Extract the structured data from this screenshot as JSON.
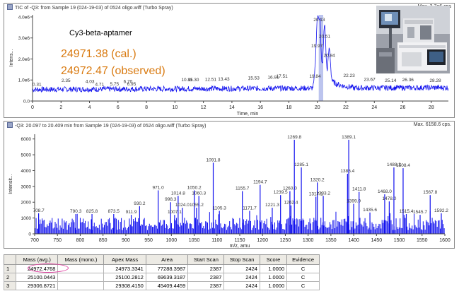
{
  "tic": {
    "title": "TIC of -Q3: from Sample 19 (024-19-03) of 0524 oligo.wiff (Turbo Spray)",
    "max_label": "Max. 3.7e6 cps",
    "sample_name": "Cy3-beta-aptamer",
    "calculated": "24971.38 (cal.)",
    "observed": "24972.47 (observed)"
  },
  "ms": {
    "title": "-Q3: 20.097 to 20.409 min from Sample 19 (024-19-03) of 0524 oligo.wiff (Turbo Spray)",
    "max_label": "Max. 6158.6 cps."
  },
  "colors": {
    "trace": "#1010ee",
    "caption": "#d97a10",
    "highlight": "#e040a0",
    "selection": "#bcc4ee"
  },
  "table": {
    "headers": [
      "",
      "Mass (avg.)",
      "Mass (mono.)",
      "Apex Mass",
      "Area",
      "Start Scan",
      "Stop Scan",
      "Score",
      "Evidence"
    ],
    "rows": [
      [
        "1",
        "24972.4768",
        "",
        "24973.3341",
        "77288.3987",
        "2387",
        "2424",
        "1.0000",
        "C"
      ],
      [
        "2",
        "25100.0443",
        "",
        "25100.2812",
        "69639.3187",
        "2387",
        "2424",
        "1.0000",
        "C"
      ],
      [
        "3",
        "29306.8721",
        "",
        "29308.4150",
        "45409.4459",
        "2387",
        "2424",
        "1.0000",
        "C"
      ]
    ]
  },
  "chart_data": [
    {
      "type": "line",
      "title": "TIC of -Q3: from Sample 19 (024-19-03) of 0524 oligo.wiff (Turbo Spray)",
      "xlabel": "Time, min",
      "ylabel": "Intens...",
      "xlim": [
        0,
        29.2
      ],
      "ylim": [
        0,
        4100000.0
      ],
      "x_ticks": [
        0,
        2,
        4,
        6,
        8,
        10,
        12,
        14,
        16,
        18,
        20,
        22,
        24,
        26,
        28
      ],
      "y_ticks": [
        {
          "v": 0,
          "label": "0.0"
        },
        {
          "v": 1000000.0,
          "label": "1.0e6"
        },
        {
          "v": 2000000.0,
          "label": "2.0e6"
        },
        {
          "v": 3000000.0,
          "label": "3.0e6"
        },
        {
          "v": 4000000.0,
          "label": "4.0e6"
        }
      ],
      "selection_range": [
        20.097,
        20.409
      ],
      "baseline": 550000.0,
      "peaks": [
        {
          "x": 19.84,
          "y": 1000000.0,
          "label": "19.84"
        },
        {
          "x": 19.97,
          "y": 2450000.0,
          "label": "19.97"
        },
        {
          "x": 20.13,
          "y": 3700000.0,
          "label": "20.13"
        },
        {
          "x": 20.51,
          "y": 2900000.0,
          "label": "20.51"
        },
        {
          "x": 20.84,
          "y": 2000000.0,
          "label": "20.84"
        }
      ],
      "annotations": [
        {
          "x": 0.31,
          "y": 630000.0,
          "label": "0.31"
        },
        {
          "x": 2.35,
          "y": 810000.0,
          "label": "2.35"
        },
        {
          "x": 4.03,
          "y": 760000.0,
          "label": "4.03"
        },
        {
          "x": 4.71,
          "y": 630000.0,
          "label": "4.71"
        },
        {
          "x": 5.75,
          "y": 640000.0,
          "label": "5.75"
        },
        {
          "x": 6.7,
          "y": 760000.0,
          "label": "6.70"
        },
        {
          "x": 6.95,
          "y": 640000.0,
          "label": "6.95"
        },
        {
          "x": 10.85,
          "y": 840000.0,
          "label": "10.85"
        },
        {
          "x": 11.3,
          "y": 840000.0,
          "label": "11.30"
        },
        {
          "x": 12.51,
          "y": 860000.0,
          "label": "12.51"
        },
        {
          "x": 13.43,
          "y": 880000.0,
          "label": "13.43"
        },
        {
          "x": 15.53,
          "y": 920000.0,
          "label": "15.53"
        },
        {
          "x": 16.91,
          "y": 960000.0,
          "label": "16.91"
        },
        {
          "x": 17.51,
          "y": 1000000.0,
          "label": "17.51"
        },
        {
          "x": 22.23,
          "y": 1050000.0,
          "label": "22.23"
        },
        {
          "x": 23.67,
          "y": 860000.0,
          "label": "23.67"
        },
        {
          "x": 25.14,
          "y": 810000.0,
          "label": "25.14"
        },
        {
          "x": 26.36,
          "y": 840000.0,
          "label": "26.36"
        },
        {
          "x": 28.28,
          "y": 810000.0,
          "label": "28.28"
        }
      ]
    },
    {
      "type": "bar",
      "title": "-Q3: 20.097 to 20.409 min from Sample 19 (024-19-03) of 0524 oligo.wiff (Turbo Spray)",
      "xlabel": "m/z, amu",
      "ylabel": "Intensit...",
      "xlim": [
        700,
        1600
      ],
      "ylim": [
        0,
        6300
      ],
      "x_ticks": [
        700,
        750,
        800,
        850,
        900,
        950,
        1000,
        1050,
        1100,
        1150,
        1200,
        1250,
        1300,
        1350,
        1400,
        1450,
        1500,
        1550,
        1600
      ],
      "y_ticks": [
        0,
        1000,
        2000,
        3000,
        4000,
        5000,
        6000
      ],
      "noise_floor": 600,
      "peaks": [
        {
          "x": 708.7,
          "y": 1300,
          "label": "708.7"
        },
        {
          "x": 790.3,
          "y": 1250,
          "label": "790.3"
        },
        {
          "x": 825.8,
          "y": 1250,
          "label": "825.8"
        },
        {
          "x": 873.5,
          "y": 1250,
          "label": "873.5"
        },
        {
          "x": 911.9,
          "y": 1200,
          "label": "911.9"
        },
        {
          "x": 930.2,
          "y": 1750,
          "label": "930.2"
        },
        {
          "x": 971.0,
          "y": 2750,
          "label": "971.0"
        },
        {
          "x": 998.3,
          "y": 2000,
          "label": "998.3"
        },
        {
          "x": 1007.1,
          "y": 1200,
          "label": "1007.1"
        },
        {
          "x": 1014.8,
          "y": 2400,
          "label": "1014.8"
        },
        {
          "x": 1024.0,
          "y": 1650,
          "label": "1024.0"
        },
        {
          "x": 1050.2,
          "y": 2750,
          "label": "1050.2"
        },
        {
          "x": 1055.2,
          "y": 1650,
          "label": "1055.2"
        },
        {
          "x": 1060.3,
          "y": 2400,
          "label": "1060.3"
        },
        {
          "x": 1091.8,
          "y": 4500,
          "label": "1091.8"
        },
        {
          "x": 1105.3,
          "y": 1450,
          "label": "1105.3"
        },
        {
          "x": 1155.7,
          "y": 2700,
          "label": "1155.7"
        },
        {
          "x": 1171.7,
          "y": 1450,
          "label": "1171.7"
        },
        {
          "x": 1194.7,
          "y": 3100,
          "label": "1194.7"
        },
        {
          "x": 1221.3,
          "y": 1650,
          "label": "1221.3"
        },
        {
          "x": 1239.5,
          "y": 2450,
          "label": "1239.5"
        },
        {
          "x": 1260.0,
          "y": 2700,
          "label": "1260.0"
        },
        {
          "x": 1262.4,
          "y": 1800,
          "label": "1262.4"
        },
        {
          "x": 1269.8,
          "y": 5950,
          "label": "1269.8"
        },
        {
          "x": 1285.1,
          "y": 4200,
          "label": "1285.1"
        },
        {
          "x": 1317.1,
          "y": 2350,
          "label": "1317.1"
        },
        {
          "x": 1320.2,
          "y": 3250,
          "label": "1320.2"
        },
        {
          "x": 1333.2,
          "y": 2400,
          "label": "1333.2"
        },
        {
          "x": 1386.4,
          "y": 3800,
          "label": "1386.4"
        },
        {
          "x": 1389.1,
          "y": 5950,
          "label": "1389.1"
        },
        {
          "x": 1399.9,
          "y": 1900,
          "label": "1399.9"
        },
        {
          "x": 1411.8,
          "y": 2650,
          "label": "1411.8"
        },
        {
          "x": 1435.6,
          "y": 1350,
          "label": "1435.6"
        },
        {
          "x": 1468.0,
          "y": 2500,
          "label": "1468.0"
        },
        {
          "x": 1478.0,
          "y": 2050,
          "label": "1478.0"
        },
        {
          "x": 1488.2,
          "y": 4200,
          "label": "1488.2"
        },
        {
          "x": 1508.4,
          "y": 4150,
          "label": "1508.4"
        },
        {
          "x": 1515.4,
          "y": 1250,
          "label": "1515.4"
        },
        {
          "x": 1545.7,
          "y": 1200,
          "label": "1545.7"
        },
        {
          "x": 1567.8,
          "y": 2450,
          "label": "1567.8"
        },
        {
          "x": 1592.2,
          "y": 1300,
          "label": "1592.2"
        }
      ]
    }
  ]
}
